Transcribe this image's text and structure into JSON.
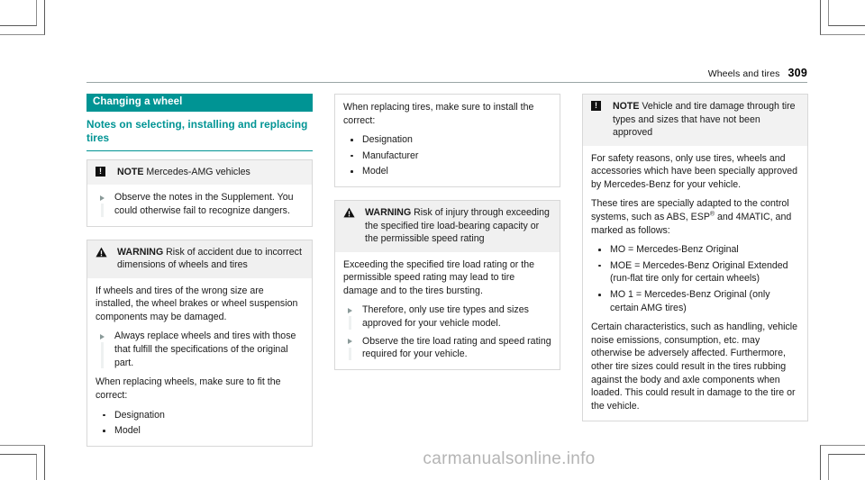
{
  "header": {
    "title": "Wheels and tires",
    "page_number": "309"
  },
  "watermark": "carmanualsonline.info",
  "symbols": {
    "note_glyph": "!",
    "warning_glyph": "warning-triangle"
  },
  "left_column": {
    "section_title": "Changing a wheel",
    "sub_title": "Notes on selecting, installing and replacing tires",
    "note_box": {
      "label": "NOTE",
      "head_rest": " Mercedes-AMG vehicles",
      "items": [
        "Observe the notes in the Supplement. You could otherwise fail to recognize dangers."
      ]
    },
    "warning_box": {
      "label": "WARNING",
      "head_rest": " Risk of accident due to incorrect dimensions of wheels and tires",
      "para_1": "If wheels and tires of the wrong size are installed, the wheel brakes or wheel suspension components may be damaged.",
      "items": [
        "Always replace wheels and tires with those that fulfill the specifications of the original part."
      ],
      "para_2": "When replacing wheels, make sure to fit the correct:",
      "bullets": [
        "Designation",
        "Model"
      ]
    }
  },
  "middle_column": {
    "intro_box": {
      "para": "When replacing tires, make sure to install the correct:",
      "bullets": [
        "Designation",
        "Manufacturer",
        "Model"
      ]
    },
    "warning_box": {
      "label": "WARNING",
      "head_rest": " Risk of injury through exceeding the specified tire load-bearing capacity or the permissible speed rating",
      "para_1": "Exceeding the specified tire load rating or the permissible speed rating may lead to tire damage and to the tires bursting.",
      "items": [
        "Therefore, only use tire types and sizes approved for your vehicle model.",
        "Observe the tire load rating and speed rating required for your vehicle."
      ]
    }
  },
  "right_column": {
    "note_box": {
      "label": "NOTE",
      "head_rest": " Vehicle and tire damage through tire types and sizes that have not been approved",
      "para_1": "For safety reasons, only use tires, wheels and accessories which have been specially approved by Mercedes-Benz for your vehicle.",
      "para_2_pre": "These tires are specially adapted to the control systems, such as ABS, ESP",
      "para_2_sup": "®",
      "para_2_post": " and 4MATIC, and marked as follows:",
      "bullets": [
        "MO = Mercedes-Benz Original",
        "MOE = Mercedes-Benz Original Extended (run-flat tire only for certain wheels)",
        "MO 1 = Mercedes-Benz Original (only certain AMG tires)"
      ],
      "para_3": "Certain characteristics, such as handling, vehicle noise emissions, consumption, etc. may otherwise be adversely affected. Furthermore, other tire sizes could result in the tires rubbing against the body and axle components when loaded. This could result in damage to the tire or the vehicle."
    }
  },
  "colors": {
    "accent_teal": "#009494",
    "box_head_gray": "#f0f0f0",
    "box_border": "#d8d8d8"
  }
}
